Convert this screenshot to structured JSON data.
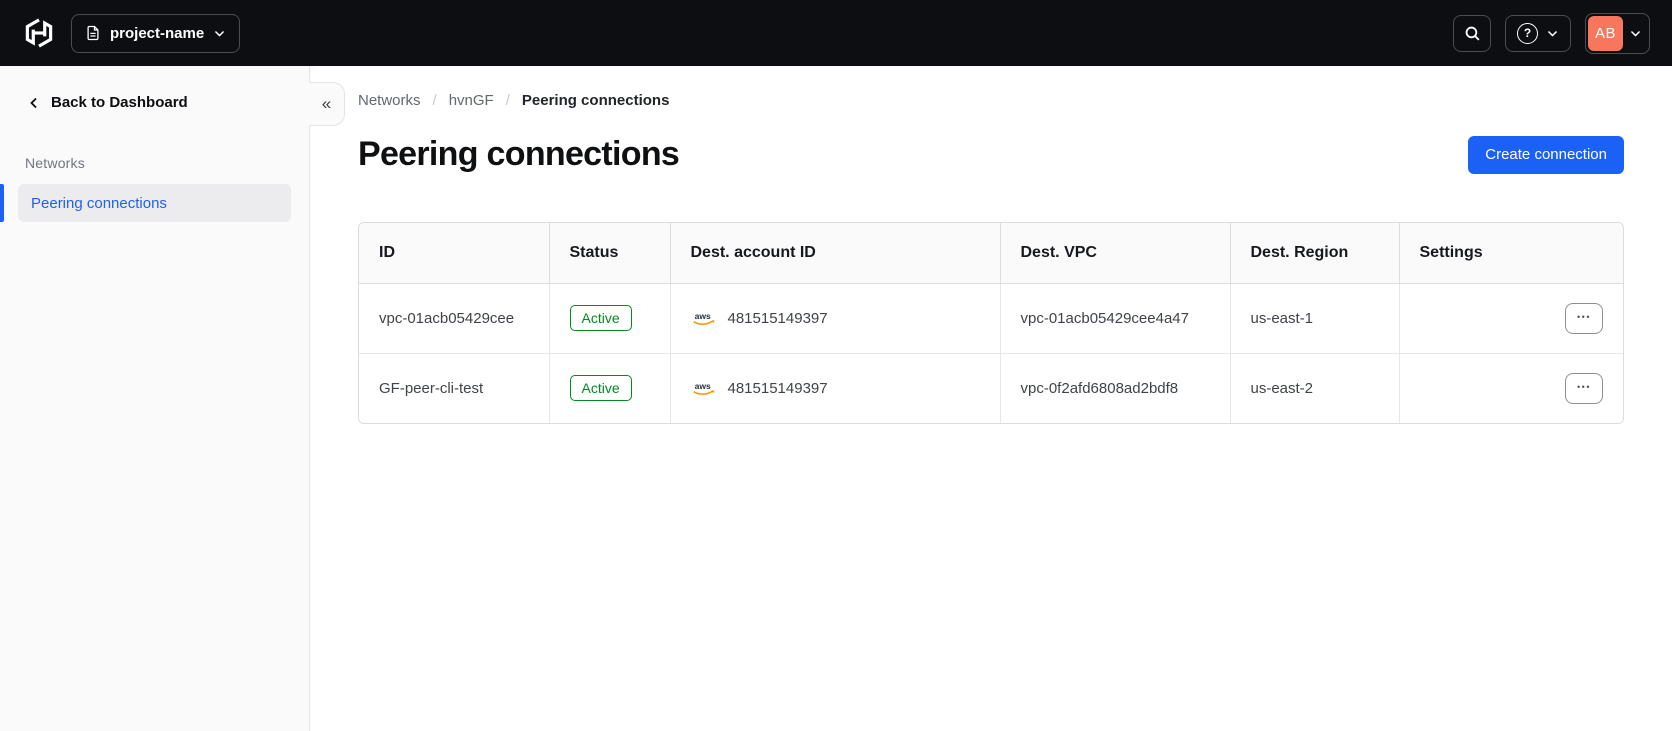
{
  "topnav": {
    "project_selector_label": "project-name",
    "avatar_initials": "AB"
  },
  "icons": {
    "help_glyph": "?",
    "collapse_glyph": "«",
    "ellipsis_glyph": "•••",
    "breadcrumb_separator": "/",
    "aws_label": "aws"
  },
  "colors": {
    "topnav_bg": "#0d0e12",
    "sidebar_bg": "#fafafa",
    "accent_blue": "#1c61f5",
    "success_green": "#008a22",
    "avatar_coral": "#f8765c",
    "aws_orange": "#f79400"
  },
  "sidebar": {
    "back_label": "Back to Dashboard",
    "section_label": "Networks",
    "items": [
      {
        "label": "Peering connections",
        "active": true
      }
    ]
  },
  "breadcrumb": {
    "items": [
      "Networks",
      "hvnGF",
      "Peering connections"
    ]
  },
  "page": {
    "title": "Peering connections",
    "create_button_label": "Create connection"
  },
  "table": {
    "columns": [
      "ID",
      "Status",
      "Dest. account ID",
      "Dest. VPC",
      "Dest. Region",
      "Settings"
    ],
    "rows": [
      {
        "id": "vpc-01acb05429cee",
        "status": "Active",
        "account_id": "481515149397",
        "vpc": "vpc-01acb05429cee4a47",
        "region": "us-east-1"
      },
      {
        "id": "GF-peer-cli-test",
        "status": "Active",
        "account_id": "481515149397",
        "vpc": "vpc-0f2afd6808ad2bdf8",
        "region": "us-east-2"
      }
    ]
  }
}
